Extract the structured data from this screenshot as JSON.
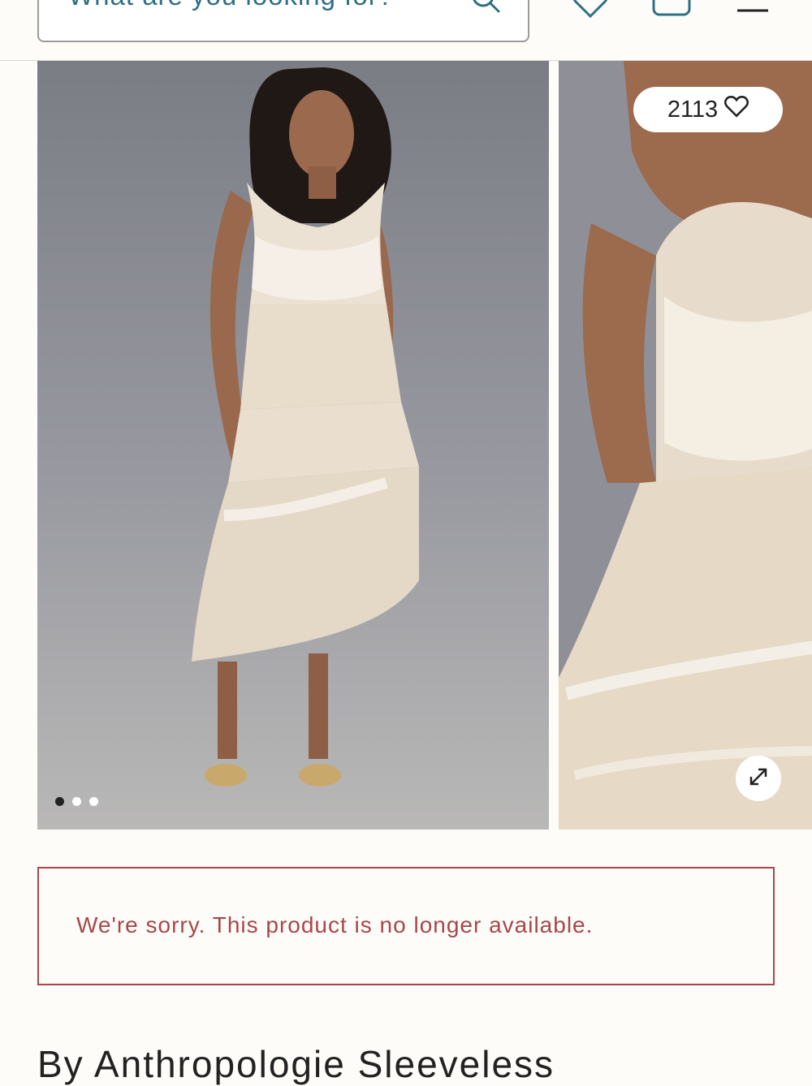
{
  "search": {
    "placeholder": "What are you looking for?",
    "icon": "search-icon"
  },
  "header_icons": [
    "heart-icon",
    "bag-icon",
    "menu-icon"
  ],
  "carousel": {
    "slide_count": 3,
    "active_slide": 1,
    "favorites_count": "2113",
    "favorite_icon": "heart-icon",
    "zoom_icon": "expand-icon"
  },
  "alert": {
    "message": "We're sorry. This product is no longer available."
  },
  "product": {
    "title": "By Anthropologie Sleeveless"
  },
  "colors": {
    "accent": "#2f6f83",
    "alert": "#a8474b",
    "background": "#fdfcf9"
  }
}
